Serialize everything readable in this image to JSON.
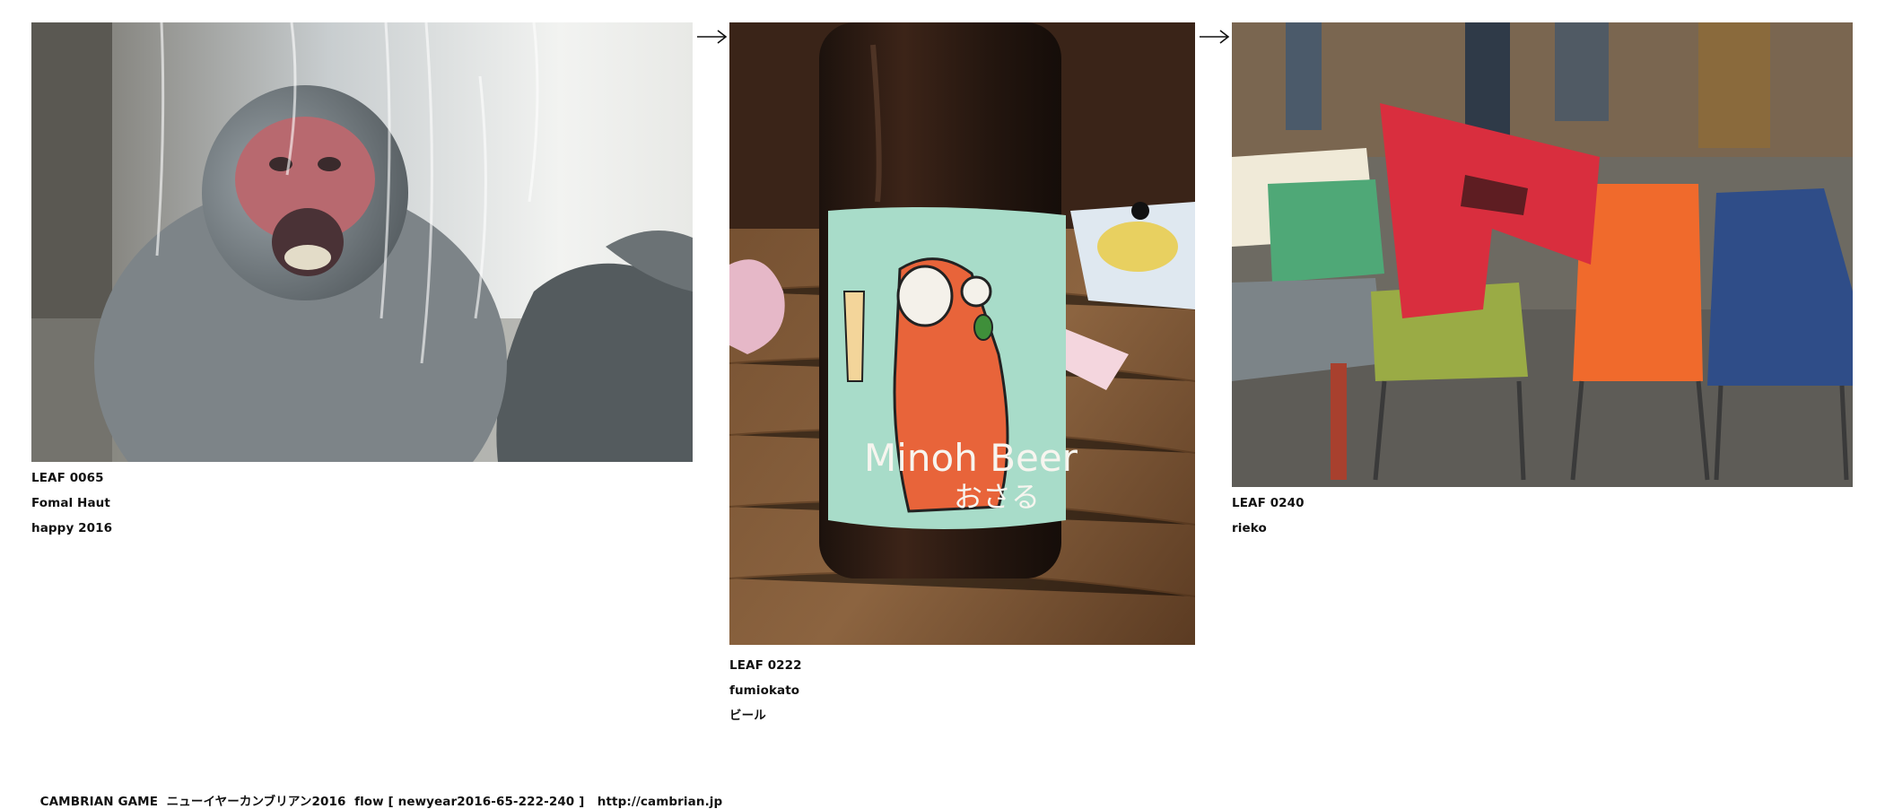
{
  "leaves": [
    {
      "id": "LEAF 0065",
      "author": "Fomal Haut",
      "caption": "happy 2016",
      "image": "monkey-behind-glass-photo"
    },
    {
      "id": "LEAF 0222",
      "author": "fumiokato",
      "caption": "ビール",
      "image": "minoh-beer-bottle-photo",
      "bottle_label": "Minoh Beer",
      "bottle_sublabel": "おさる"
    },
    {
      "id": "LEAF 0240",
      "author": "rieko",
      "caption": "",
      "image": "colorful-chairs-photo"
    }
  ],
  "arrows": [
    "arrow-right-icon",
    "arrow-right-icon"
  ],
  "footer": {
    "game": "CAMBRIAN GAME",
    "title": "ニューイヤーカンブリアン2016",
    "flow": "flow [ newyear2016-65-222-240 ]",
    "url": "http://cambrian.jp"
  },
  "colors": {
    "background": "#ffffff",
    "text": "#111111"
  }
}
